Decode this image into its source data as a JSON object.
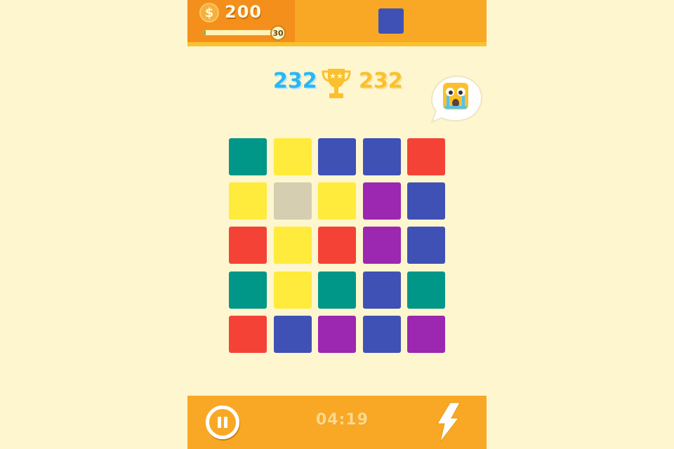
{
  "header": {
    "coin_symbol": "$",
    "coins": "200",
    "level": "30",
    "xp_progress": 0.03,
    "next_color": "#3f51b5"
  },
  "scores": {
    "player": "232",
    "best": "232"
  },
  "bubble": {
    "icon": "crying-face-icon"
  },
  "colors": {
    "green": "#009688",
    "yellow": "#ffeb3b",
    "blue": "#3f51b5",
    "red": "#f44336",
    "purple": "#9c27b0",
    "gray": "#d5ceb1",
    "bar_orange": "#f9a825"
  },
  "board": [
    [
      "green",
      "yellow",
      "blue",
      "blue",
      "red"
    ],
    [
      "yellow",
      "gray",
      "yellow",
      "purple",
      "blue"
    ],
    [
      "red",
      "yellow",
      "red",
      "purple",
      "blue"
    ],
    [
      "green",
      "yellow",
      "green",
      "blue",
      "green"
    ],
    [
      "red",
      "blue",
      "purple",
      "blue",
      "purple"
    ]
  ],
  "footer": {
    "timer": "04:19",
    "pause_icon": "pause-icon",
    "power_icon": "lightning-icon"
  }
}
